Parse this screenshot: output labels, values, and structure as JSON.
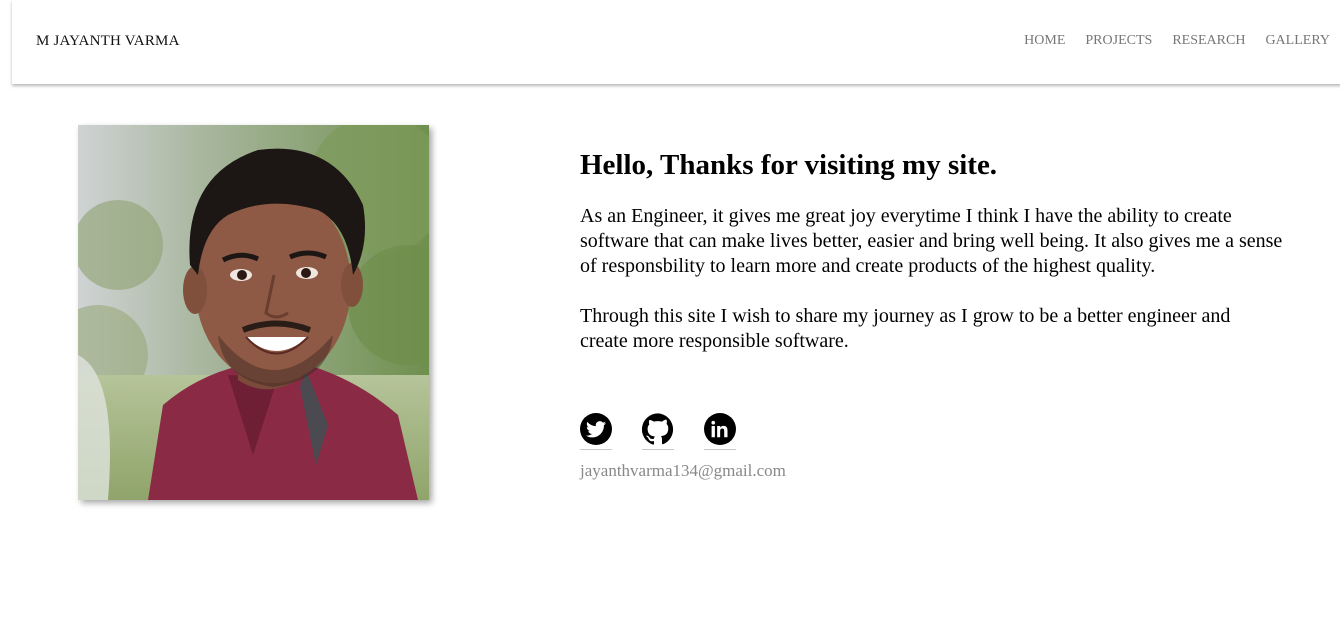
{
  "header": {
    "brand": "M JAYANTH VARMA",
    "nav": [
      "HOME",
      "PROJECTS",
      "RESEARCH",
      "GALLERY"
    ]
  },
  "profile": {
    "photo_icon": "profile-photo"
  },
  "intro": {
    "heading": "Hello, Thanks for visiting my site.",
    "paragraph1_lines": [
      "As an Engineer, it gives me great joy everytime I think I have the ability to create",
      "software that can make lives better, easier and bring well being. It also gives me a sense",
      "of responsbility to learn more and create products of the highest quality."
    ],
    "paragraph2_lines": [
      "Through this site I wish to share my journey as I grow to be a better engineer and",
      "create more responsible software."
    ]
  },
  "socials": [
    {
      "icon": "twitter-icon"
    },
    {
      "icon": "github-icon"
    },
    {
      "icon": "linkedin-icon"
    }
  ],
  "contact": {
    "email": "jayanthvarma134@gmail.com"
  },
  "colors": {
    "nav_text": "#777777",
    "email_text": "#888888",
    "shirt": "#8a2a45"
  }
}
